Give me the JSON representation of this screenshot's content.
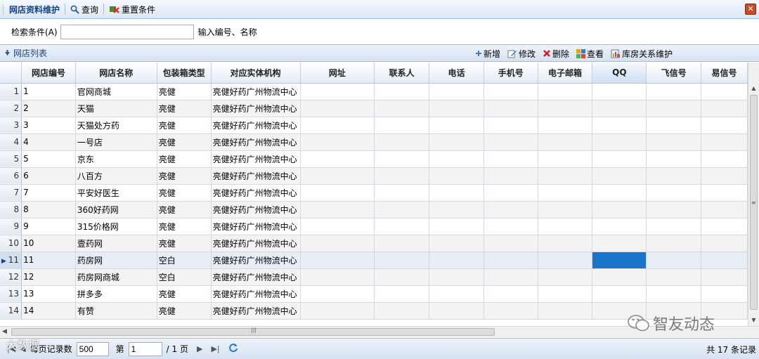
{
  "toolbar": {
    "title": "网店资料维护",
    "query": "查询",
    "reset": "重置条件",
    "close": "✕"
  },
  "search": {
    "label": "检索条件(A)",
    "value": "",
    "placeholder": "",
    "hint": "输入编号、名称"
  },
  "panel": {
    "title": "网店列表",
    "actions": {
      "add": "新增",
      "edit": "修改",
      "delete": "删除",
      "view": "查看",
      "warehouse": "库房关系维护"
    }
  },
  "grid": {
    "columns": [
      "网店编号",
      "网店名称",
      "包装箱类型",
      "对应实体机构",
      "网址",
      "联系人",
      "电话",
      "手机号",
      "电子邮箱",
      "QQ",
      "飞信号",
      "易信号"
    ],
    "rows": [
      {
        "n": "1",
        "id": "1",
        "name": "官网商城",
        "box": "亮健",
        "org": "亮健好药广州物流中心"
      },
      {
        "n": "2",
        "id": "2",
        "name": "天猫",
        "box": "亮健",
        "org": "亮健好药广州物流中心"
      },
      {
        "n": "3",
        "id": "3",
        "name": "天猫处方药",
        "box": "亮健",
        "org": "亮健好药广州物流中心"
      },
      {
        "n": "4",
        "id": "4",
        "name": "一号店",
        "box": "亮健",
        "org": "亮健好药广州物流中心"
      },
      {
        "n": "5",
        "id": "5",
        "name": "京东",
        "box": "亮健",
        "org": "亮健好药广州物流中心"
      },
      {
        "n": "6",
        "id": "6",
        "name": "八百方",
        "box": "亮健",
        "org": "亮健好药广州物流中心"
      },
      {
        "n": "7",
        "id": "7",
        "name": "平安好医生",
        "box": "亮健",
        "org": "亮健好药广州物流中心"
      },
      {
        "n": "8",
        "id": "8",
        "name": "360好药网",
        "box": "亮健",
        "org": "亮健好药广州物流中心"
      },
      {
        "n": "9",
        "id": "9",
        "name": "315价格网",
        "box": "亮健",
        "org": "亮健好药广州物流中心"
      },
      {
        "n": "10",
        "id": "10",
        "name": "壹药网",
        "box": "亮健",
        "org": "亮健好药广州物流中心"
      },
      {
        "n": "11",
        "id": "11",
        "name": "药房网",
        "box": "空白",
        "org": "亮健好药广州物流中心"
      },
      {
        "n": "12",
        "id": "12",
        "name": "药房网商城",
        "box": "空白",
        "org": "亮健好药广州物流中心"
      },
      {
        "n": "13",
        "id": "13",
        "name": "拼多多",
        "box": "亮健",
        "org": "亮健好药广州物流中心"
      },
      {
        "n": "14",
        "id": "14",
        "name": "有赞",
        "box": "亮健",
        "org": "亮健好药广州物流中心"
      }
    ],
    "selected_row": "11",
    "selected_column": "QQ"
  },
  "pager": {
    "page_size_label": "每页记录数",
    "page_size": "500",
    "page_label": "第",
    "page": "1",
    "total_pages": "/ 1 页",
    "total": "共 17 条记录"
  },
  "watermark": {
    "right": "智友动态",
    "left": "大数据"
  },
  "colors": {
    "header_text": "#15428b",
    "selection": "#1a74c9",
    "border": "#99bbe8"
  }
}
